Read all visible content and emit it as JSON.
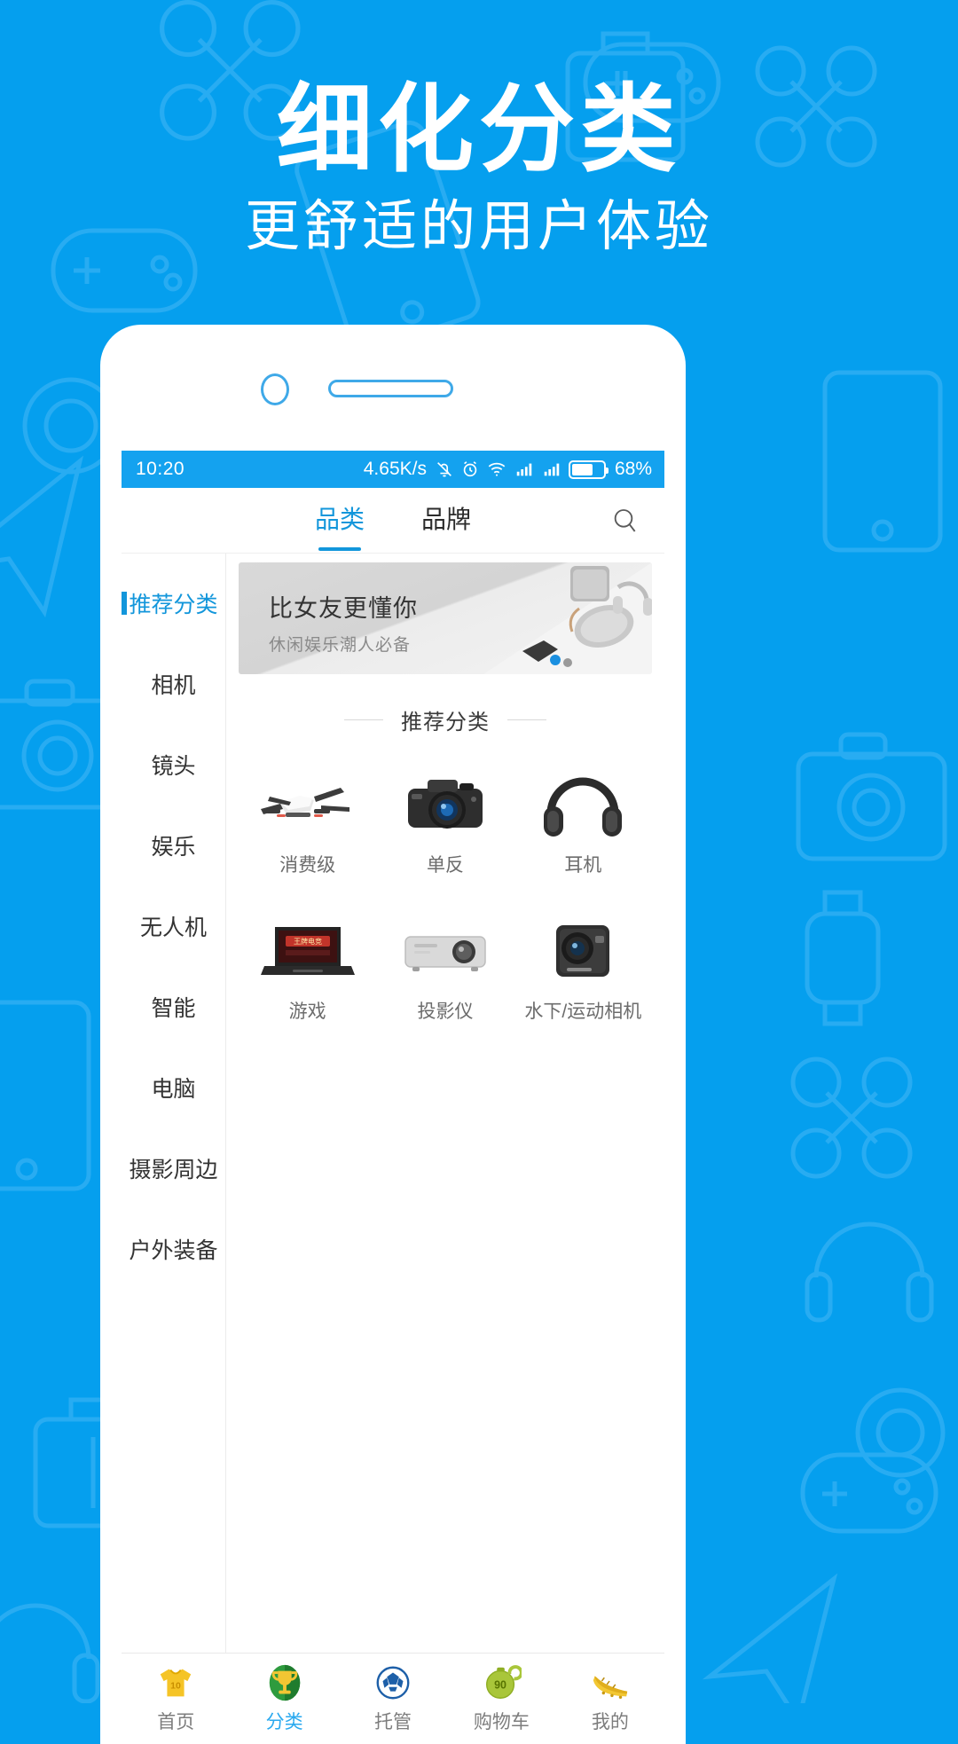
{
  "promo": {
    "title": "细化分类",
    "subtitle": "更舒适的用户体验",
    "background_color": "#059fee",
    "text_color": "#ffffff"
  },
  "phone": {
    "camera_icon": "front-camera",
    "speaker_icon": "earpiece-speaker"
  },
  "status_bar": {
    "time": "10:20",
    "network_speed": "4.65K/s",
    "icons": [
      "bell-muted-icon",
      "alarm-icon",
      "wifi-icon",
      "signal-icon",
      "signal-icon"
    ],
    "battery_percent": "68%",
    "battery_level": 68,
    "background_color": "#14a2ef"
  },
  "top_tabs": {
    "items": [
      {
        "label": "品类",
        "active": true
      },
      {
        "label": "品牌",
        "active": false
      }
    ],
    "search_icon": "search-icon",
    "accent_color": "#1296db"
  },
  "sidebar": {
    "items": [
      {
        "label": "推荐分类",
        "active": true
      },
      {
        "label": "相机",
        "active": false
      },
      {
        "label": "镜头",
        "active": false
      },
      {
        "label": "娱乐",
        "active": false
      },
      {
        "label": "无人机",
        "active": false
      },
      {
        "label": "智能",
        "active": false
      },
      {
        "label": "电脑",
        "active": false
      },
      {
        "label": "摄影周边",
        "active": false
      },
      {
        "label": "户外装备",
        "active": false
      }
    ]
  },
  "banner": {
    "title": "比女友更懂你",
    "subtitle": "休闲娱乐潮人必备",
    "art": "speaker-headphone-gamepad-photo"
  },
  "section": {
    "title": "推荐分类"
  },
  "categories": [
    {
      "label": "消费级",
      "icon": "drone-icon"
    },
    {
      "label": "单反",
      "icon": "dslr-camera-icon"
    },
    {
      "label": "耳机",
      "icon": "headphone-icon"
    },
    {
      "label": "游戏",
      "icon": "gaming-laptop-icon"
    },
    {
      "label": "投影仪",
      "icon": "projector-icon"
    },
    {
      "label": "水下/运动相机",
      "icon": "action-camera-icon"
    }
  ],
  "bottom_nav": {
    "items": [
      {
        "label": "首页",
        "icon": "jersey-icon",
        "active": false
      },
      {
        "label": "分类",
        "icon": "trophy-icon",
        "active": true
      },
      {
        "label": "托管",
        "icon": "soccer-ball-icon",
        "active": false
      },
      {
        "label": "购物车",
        "icon": "stopwatch-icon",
        "active": false
      },
      {
        "label": "我的",
        "icon": "soccer-cleat-icon",
        "active": false
      }
    ],
    "active_color": "#2aa9ef",
    "inactive_color": "#7d7d7d"
  }
}
